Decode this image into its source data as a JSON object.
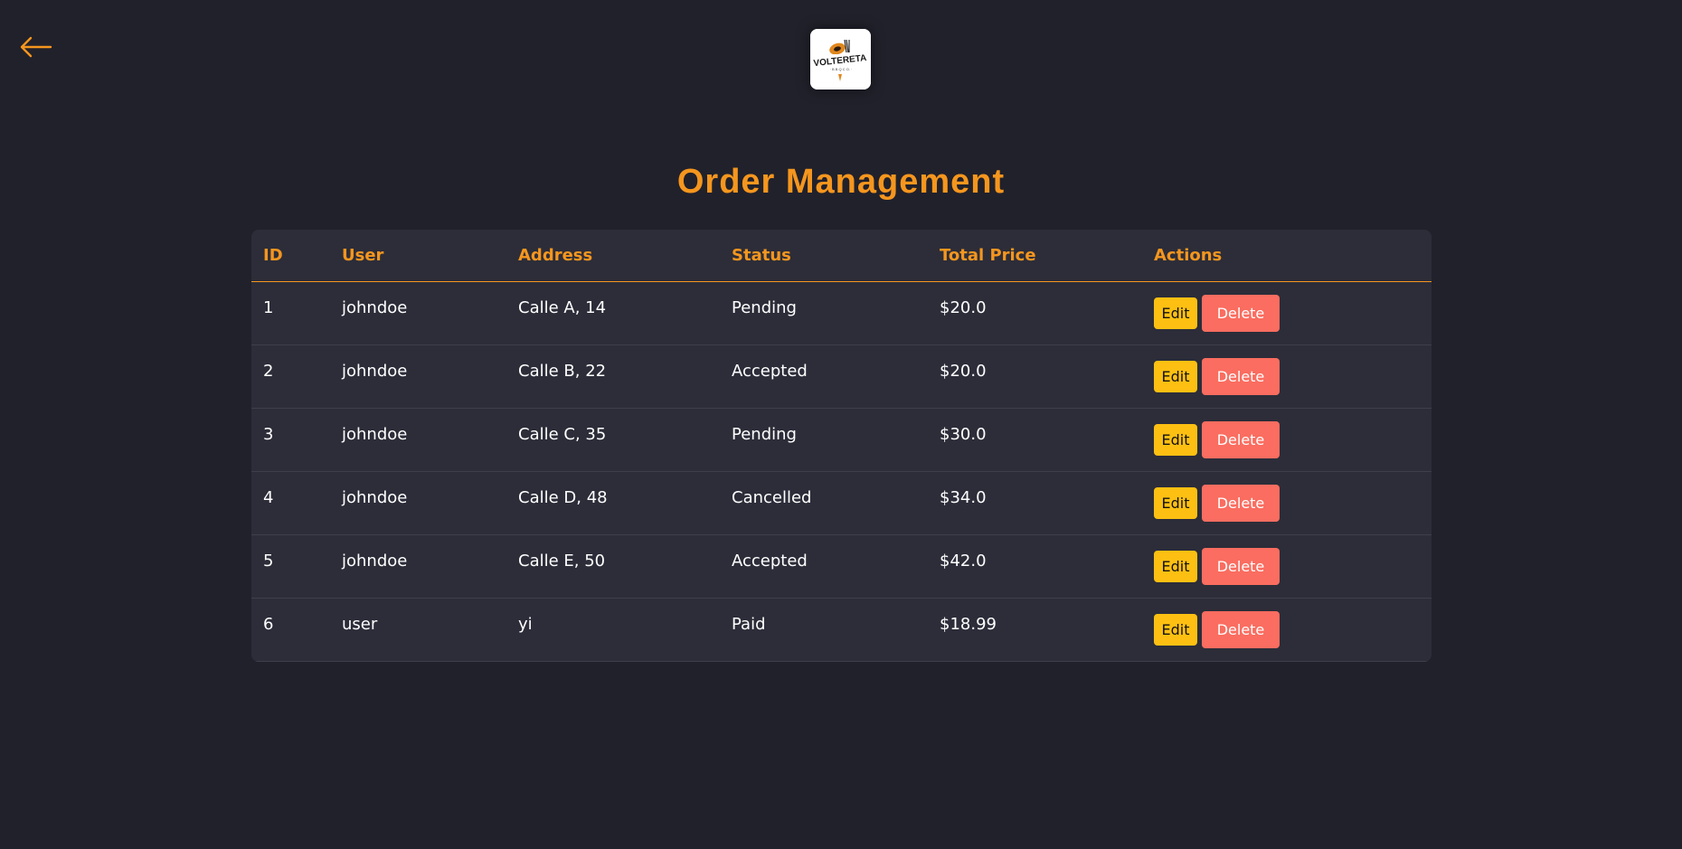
{
  "colors": {
    "background": "#21212b",
    "card": "#2c2d39",
    "accent": "#f5961e",
    "edit_button": "#fdc012",
    "delete_button": "#fa6d60",
    "row_divider": "#3e3f4b"
  },
  "nav": {
    "back_icon": "arrow-left-icon"
  },
  "logo": {
    "name": "VOLTERETA",
    "icon": "restaurant-logo"
  },
  "page": {
    "title": "Order Management"
  },
  "table": {
    "headers": [
      "ID",
      "User",
      "Address",
      "Status",
      "Total Price",
      "Actions"
    ],
    "edit_label": "Edit",
    "delete_label": "Delete",
    "rows": [
      {
        "id": "1",
        "user": "johndoe",
        "address": "Calle A, 14",
        "status": "Pending",
        "total": "$20.0"
      },
      {
        "id": "2",
        "user": "johndoe",
        "address": "Calle B, 22",
        "status": "Accepted",
        "total": "$20.0"
      },
      {
        "id": "3",
        "user": "johndoe",
        "address": "Calle C, 35",
        "status": "Pending",
        "total": "$30.0"
      },
      {
        "id": "4",
        "user": "johndoe",
        "address": "Calle D, 48",
        "status": "Cancelled",
        "total": "$34.0"
      },
      {
        "id": "5",
        "user": "johndoe",
        "address": "Calle E, 50",
        "status": "Accepted",
        "total": "$42.0"
      },
      {
        "id": "6",
        "user": "user",
        "address": "yi",
        "status": "Paid",
        "total": "$18.99"
      }
    ]
  }
}
